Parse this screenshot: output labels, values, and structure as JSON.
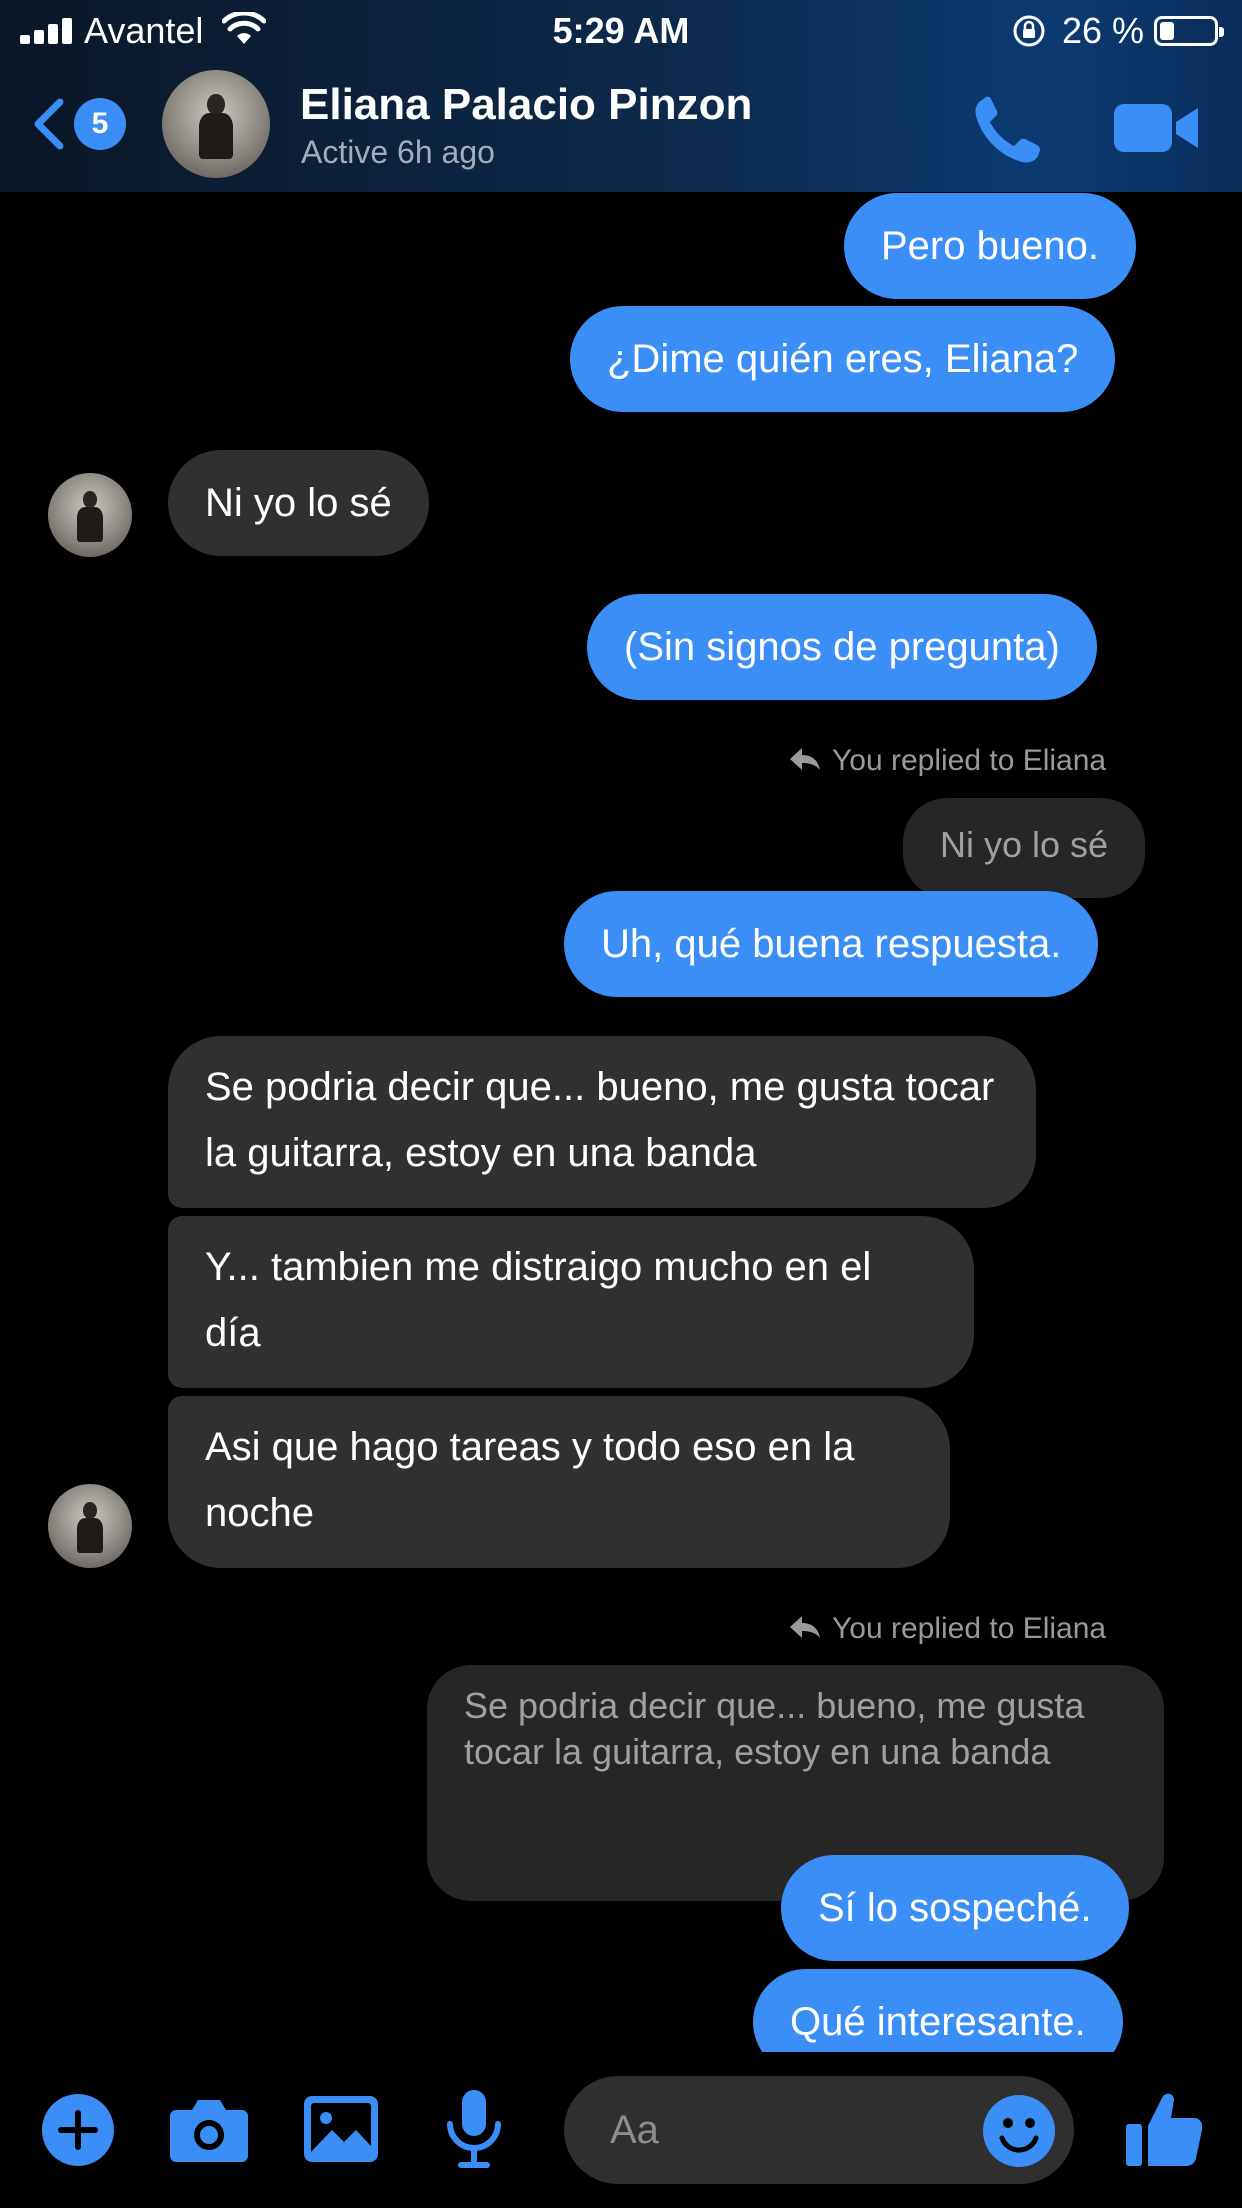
{
  "status_bar": {
    "carrier": "Avantel",
    "time": "5:29 AM",
    "battery_percent": "26 %",
    "battery_level": 0.26
  },
  "header": {
    "back_badge": "5",
    "contact_name": "Eliana Palacio Pinzon",
    "contact_status": "Active 6h ago"
  },
  "messages": {
    "m1": "Pero bueno.",
    "m2": "¿Dime quién eres, Eliana?",
    "m3": "Ni yo lo sé",
    "m4": "(Sin signos de pregunta)",
    "reply1_label": "You replied to Eliana",
    "reply1_quote": "Ni yo lo sé",
    "m5": "Uh, qué buena respuesta.",
    "m6": "Se podria decir que... bueno, me gusta tocar la guitarra, estoy en una banda",
    "m7": "Y... tambien me distraigo mucho en el día",
    "m8": "Asi que hago tareas y todo eso en la noche",
    "reply2_label": "You replied to Eliana",
    "reply2_quote": "Se podria decir que... bueno, me gusta tocar la guitarra, estoy en una banda",
    "m9": "Sí lo sospeché.",
    "m10": "Qué interesante."
  },
  "composer": {
    "placeholder": "Aa"
  },
  "colors": {
    "accent": "#3a8ef6",
    "incoming_bubble": "#303030",
    "background": "#000000"
  },
  "icons": {
    "back": "chevron-left-icon",
    "call": "phone-icon",
    "video": "video-camera-icon",
    "add": "plus-circle-icon",
    "camera": "camera-icon",
    "gallery": "image-icon",
    "mic": "microphone-icon",
    "emoji": "smiley-icon",
    "like": "thumbs-up-icon"
  }
}
